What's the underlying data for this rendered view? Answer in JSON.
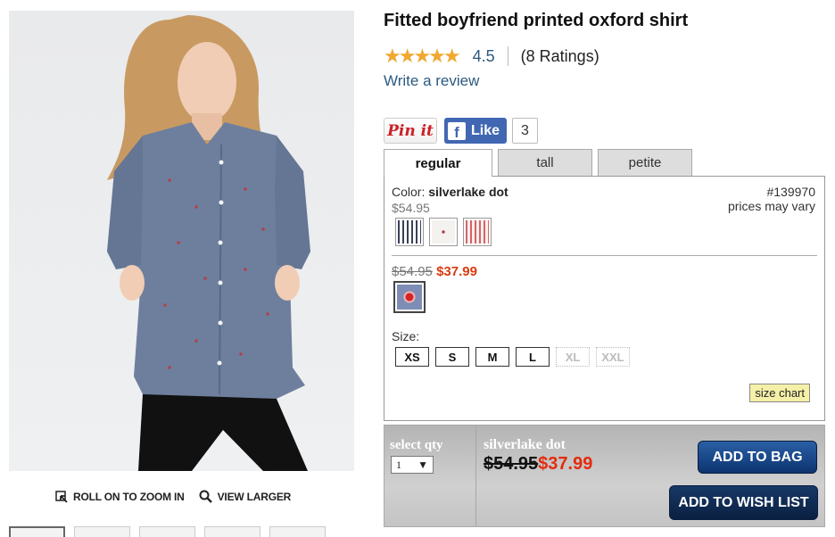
{
  "product": {
    "title": "Fitted boyfriend printed oxford shirt",
    "stars": "★★★★★",
    "rating": "4.5",
    "ratings_count": "(8 Ratings)",
    "write_review": "Write a review"
  },
  "social": {
    "pinit": "Pin it",
    "like": "Like",
    "like_count": "3",
    "fb_letter": "f"
  },
  "tabs": [
    "regular",
    "tall",
    "petite"
  ],
  "panel": {
    "color_prefix": "Color: ",
    "color_name": "silverlake dot",
    "item_no": "#139970",
    "price_note": "prices may vary",
    "base_price": "$54.95",
    "old_price": "$54.95",
    "sale_price": "$37.99",
    "size_label": "Size:",
    "sizes": [
      {
        "label": "XS",
        "available": true
      },
      {
        "label": "S",
        "available": true
      },
      {
        "label": "M",
        "available": true
      },
      {
        "label": "L",
        "available": true
      },
      {
        "label": "XL",
        "available": false
      },
      {
        "label": "XXL",
        "available": false
      }
    ],
    "size_chart": "size chart"
  },
  "image_tools": {
    "zoom": "ROLL ON TO ZOOM IN",
    "larger": "VIEW LARGER"
  },
  "buybar": {
    "qty_label": "select qty",
    "qty_value": "1",
    "color_name": "silverlake dot",
    "old_price": "$54.95",
    "sale_price": "$37.99",
    "add_to_bag": "ADD TO BAG",
    "add_to_wish": "ADD TO WISH LIST"
  },
  "colors": {
    "link": "#2b5a80",
    "sale": "#d93b11",
    "star": "#f0a830",
    "fb": "#4267b2",
    "bag_button": "#0d3470"
  }
}
